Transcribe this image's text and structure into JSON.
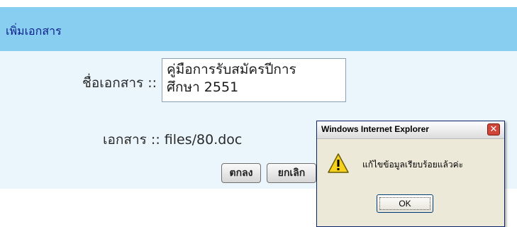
{
  "header": {
    "title": "เพิ่มเอกสาร"
  },
  "form": {
    "name_label": "ชื่อเอกสาร ::",
    "name_value_line1": "คู่มือการรับสมัครปีการ",
    "name_value_line2": "ศึกษา 2551",
    "doc_label": "เอกสาร ::",
    "doc_value": "files/80.doc",
    "ok_button": "ตกลง",
    "cancel_button": "ยกเลิก"
  },
  "dialog": {
    "title": "Windows Internet Explorer",
    "close_glyph": "✕",
    "icon": "warning-icon",
    "message": "แก้ไขข้อมูลเรียบร้อยแล้วค่ะ",
    "ok_label": "OK"
  },
  "colors": {
    "header_bg": "#87cef0",
    "panel_bg": "#eaf6fb",
    "dialog_bg": "#ece9d8",
    "warning_yellow": "#f6d21f"
  }
}
